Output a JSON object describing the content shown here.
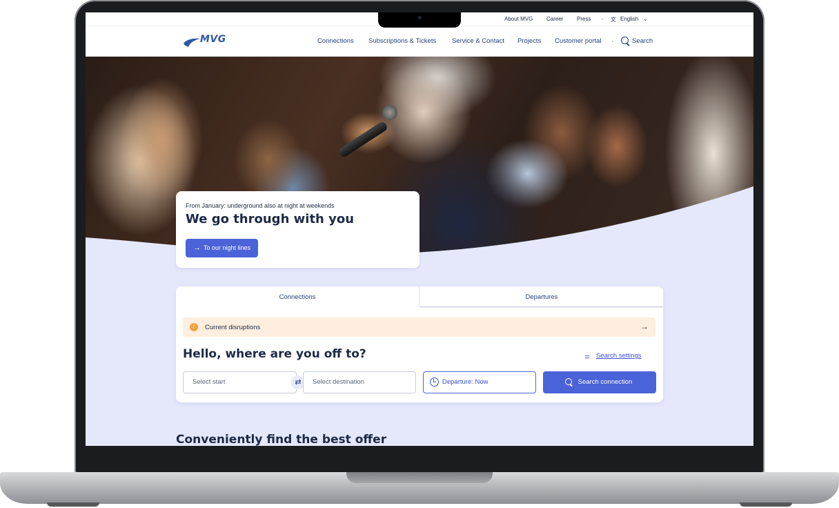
{
  "topbar": {
    "links": [
      "About MVG",
      "Career",
      "Press"
    ],
    "language": "English"
  },
  "nav": {
    "logo": "MVG",
    "items": [
      "Connections",
      "Subscriptions & Tickets",
      "Service & Contact",
      "Projects",
      "Customer portal"
    ],
    "search": "Search"
  },
  "promo": {
    "kicker": "From January: underground also at night at weekends",
    "title": "We go through with you",
    "cta": "To our night lines"
  },
  "planner": {
    "tabs": [
      "Connections",
      "Departures"
    ],
    "disruptions": "Current disruptions",
    "heading": "Hello, where are you off to?",
    "settings": "Search settings",
    "start_placeholder": "Select start",
    "destination_placeholder": "Select destination",
    "departure": "Departure: Now",
    "search_button": "Search connection"
  },
  "offer_heading": "Conveniently find the best offer",
  "colors": {
    "brand": "#2e57a8",
    "primary_button": "#4b63d8",
    "hero_background": "#e5e8fb",
    "alert": "#fdeedf"
  }
}
